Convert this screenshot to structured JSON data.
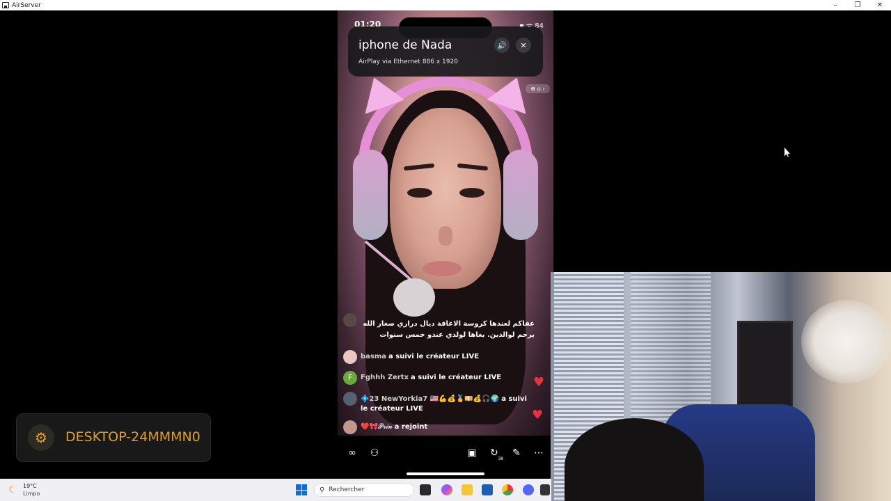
{
  "window": {
    "title": "AirServer",
    "minimize": "–",
    "restore": "❐",
    "close": "✕"
  },
  "phone": {
    "time": "01:20",
    "status_icons": "▪ ᯤ 84",
    "overlay": {
      "device_name": "iphone de Nada",
      "connection": "AirPlay via Ethernet 886 x 1920",
      "sound_icon": "🔊",
      "close_icon": "✕"
    },
    "comments": [
      {
        "name": "basma",
        "text": "a suivi le créateur LIVE",
        "avatar_color": "#e8c8c0"
      },
      {
        "name": "Fghhh Zertx",
        "text": "a suivi le créateur LIVE",
        "avatar_color": "#6aaa3a",
        "avatar_letter": "F"
      },
      {
        "name": "💠23 NewYorkia7 🇺🇸💪💰🥇💴💰🎧🌍",
        "text": "a suivi le créateur LIVE",
        "avatar_color": "#556070"
      },
      {
        "name": "❤️🎀𝒫𝓇𝒾𝓃",
        "text": "a rejoint",
        "avatar_color": "#c09890"
      }
    ],
    "arabic_comment": "عفاكم لعندها كروسة الاعاقة ديال دراري صغار الله يرحم لوالدين. بغاها لولدي عندو خمس سنوات",
    "share_count": "38"
  },
  "widget": {
    "label": "DESKTOP-24MMMN0"
  },
  "taskbar": {
    "temp": "19°C",
    "weather": "Limpo",
    "search_placeholder": "Rechercher"
  }
}
